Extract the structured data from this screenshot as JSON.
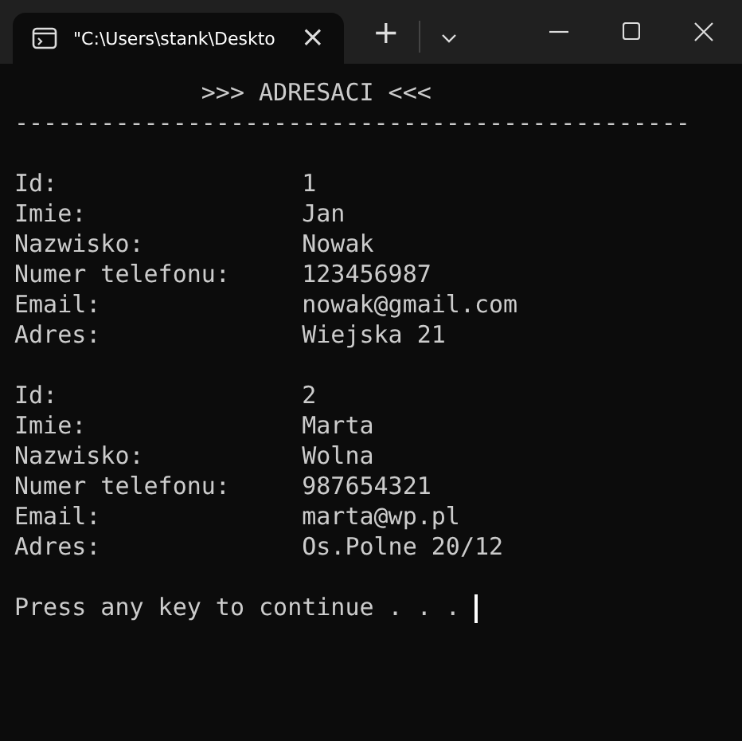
{
  "tab": {
    "title": "\"C:\\Users\\stank\\Deskto",
    "close": "×"
  },
  "toolbar": {
    "new_tab": "+"
  },
  "console": {
    "heading": ">>> ADRESACI <<<",
    "rule": "-----------------------------------------------",
    "records": [
      {
        "fields": [
          {
            "label": "Id:",
            "value": "1"
          },
          {
            "label": "Imie:",
            "value": "Jan"
          },
          {
            "label": "Nazwisko:",
            "value": "Nowak"
          },
          {
            "label": "Numer telefonu:",
            "value": "123456987"
          },
          {
            "label": "Email:",
            "value": "nowak@gmail.com"
          },
          {
            "label": "Adres:",
            "value": "Wiejska 21"
          }
        ]
      },
      {
        "fields": [
          {
            "label": "Id:",
            "value": "2"
          },
          {
            "label": "Imie:",
            "value": "Marta"
          },
          {
            "label": "Nazwisko:",
            "value": "Wolna"
          },
          {
            "label": "Numer telefonu:",
            "value": "987654321"
          },
          {
            "label": "Email:",
            "value": "marta@wp.pl"
          },
          {
            "label": "Adres:",
            "value": "Os.Polne 20/12"
          }
        ]
      }
    ],
    "prompt": "Press any key to continue . . ."
  }
}
